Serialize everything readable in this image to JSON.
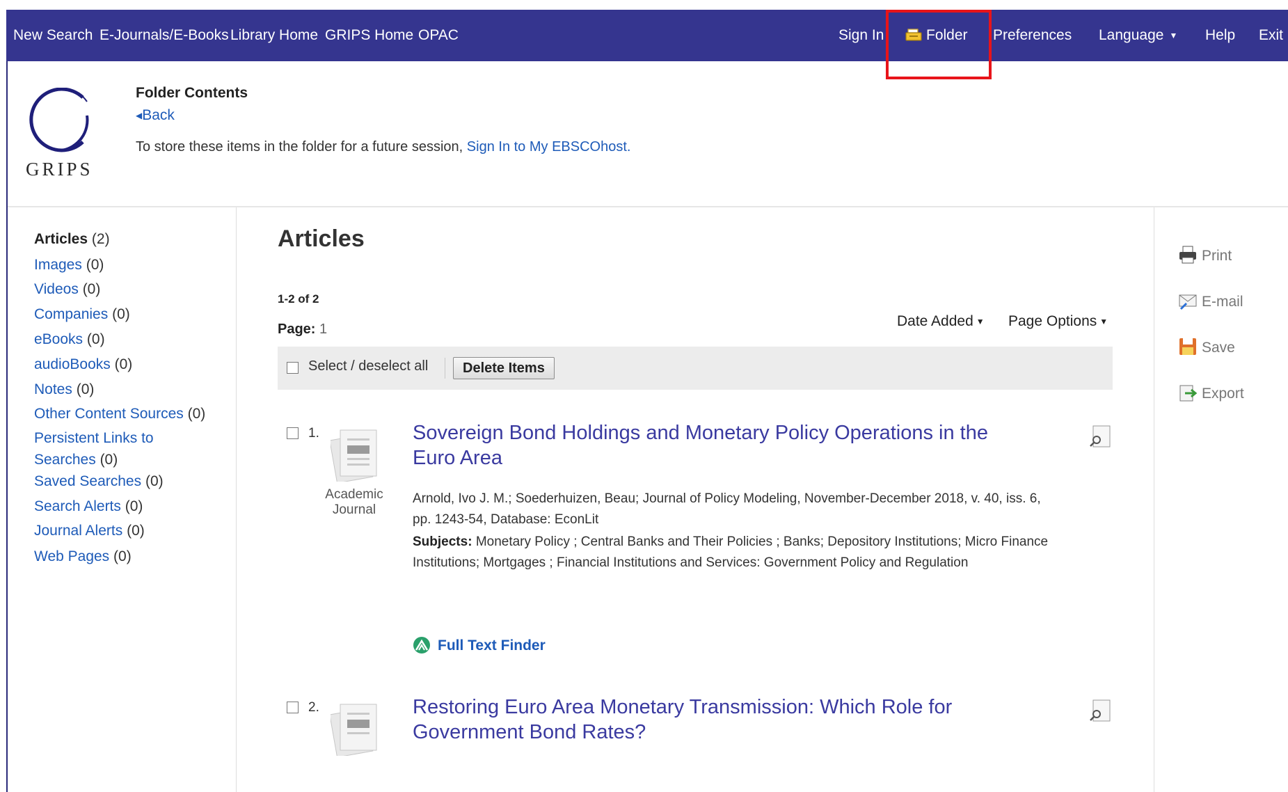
{
  "nav": {
    "left": [
      "New Search",
      "E-Journals/E-Books",
      "Library Home",
      "GRIPS Home",
      "OPAC"
    ],
    "sign_in": "Sign In",
    "folder": "Folder",
    "preferences": "Preferences",
    "language": "Language",
    "help": "Help",
    "exit": "Exit"
  },
  "header": {
    "logo_text": "GRIPS",
    "title": "Folder Contents",
    "back": "Back",
    "store_msg_prefix": "To store these items in the folder for a future session,",
    "store_msg_link": "Sign In to My EBSCOhost."
  },
  "sidebar": {
    "items": [
      {
        "label": "Articles",
        "count": "(2)"
      },
      {
        "label": "Images",
        "count": "(0)"
      },
      {
        "label": "Videos",
        "count": "(0)"
      },
      {
        "label": "Companies",
        "count": "(0)"
      },
      {
        "label": "eBooks",
        "count": "(0)"
      },
      {
        "label": "audioBooks",
        "count": "(0)"
      },
      {
        "label": "Notes",
        "count": "(0)"
      },
      {
        "label": "Other Content Sources",
        "count": "(0)"
      },
      {
        "label": "Persistent Links to",
        "label2": "Searches",
        "count": "(0)"
      },
      {
        "label": "Saved Searches",
        "count": "(0)"
      },
      {
        "label": "Search Alerts",
        "count": "(0)"
      },
      {
        "label": "Journal Alerts",
        "count": "(0)"
      },
      {
        "label": "Web Pages",
        "count": "(0)"
      }
    ]
  },
  "main": {
    "title": "Articles",
    "result_count": "1-2 of 2",
    "page_label": "Page:",
    "page_number": "1",
    "sort": "Date Added",
    "page_options": "Page Options",
    "select_all": "Select / deselect all",
    "delete_items": "Delete Items",
    "results": [
      {
        "number": "1.",
        "type_line1": "Academic",
        "type_line2": "Journal",
        "title": "Sovereign Bond Holdings and Monetary Policy Operations in the Euro Area",
        "meta": "Arnold, Ivo J. M.; Soederhuizen, Beau; Journal of Policy Modeling, November-December 2018, v. 40, iss. 6, pp. 1243-54, Database: EconLit",
        "subjects_label": "Subjects:",
        "subjects": "Monetary Policy ; Central Banks and Their Policies ; Banks; Depository Institutions; Micro Finance Institutions; Mortgages ; Financial Institutions and Services: Government Policy and Regulation",
        "full_text": "Full Text Finder"
      },
      {
        "number": "2.",
        "title": "Restoring Euro Area Monetary Transmission: Which Role for Government Bond Rates?"
      }
    ]
  },
  "tools": {
    "print": "Print",
    "email": "E-mail",
    "save": "Save",
    "export": "Export"
  },
  "colors": {
    "nav_bg": "#35358f",
    "link": "#1e5bb8",
    "title_link": "#3a3aa0",
    "highlight": "#e8141a"
  }
}
